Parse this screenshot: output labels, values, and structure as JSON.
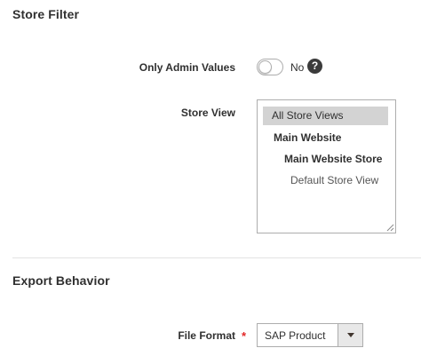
{
  "store_filter": {
    "title": "Store Filter",
    "only_admin_values": {
      "label": "Only Admin Values",
      "state_text": "No",
      "enabled": false,
      "help_icon": "question-circle-icon",
      "help_glyph": "?"
    },
    "store_view": {
      "label": "Store View",
      "options": [
        {
          "label": "All Store Views",
          "selected": true
        },
        {
          "label": "Main Website",
          "selected": false
        },
        {
          "label": "Main Website Store",
          "selected": false
        },
        {
          "label": "Default Store View",
          "selected": false
        }
      ]
    }
  },
  "export_behavior": {
    "title": "Export Behavior",
    "file_format": {
      "label": "File Format",
      "required_mark": "*",
      "value": "SAP Product"
    }
  },
  "colors": {
    "required": "#e22626",
    "selected_option_bg": "#d3d3d3"
  }
}
